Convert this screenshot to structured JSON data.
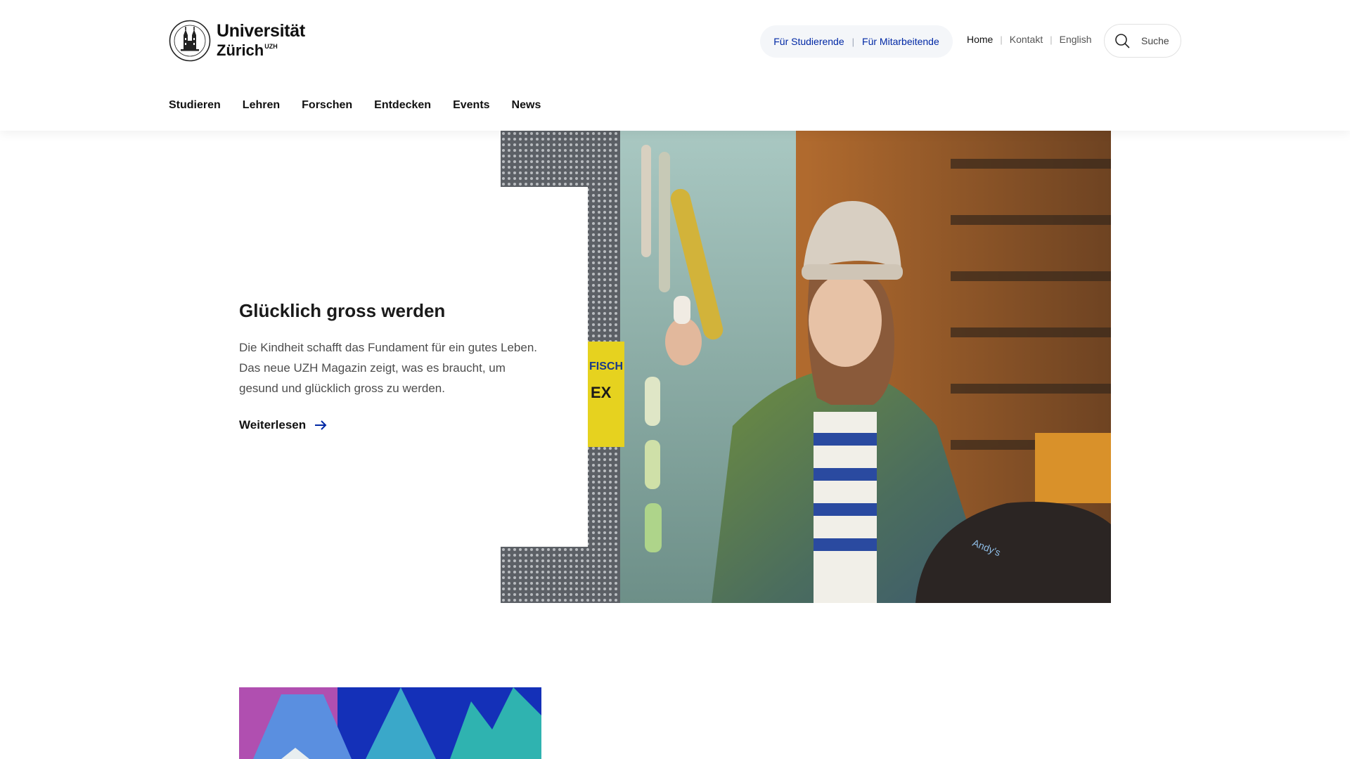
{
  "logo": {
    "line1": "Universität",
    "line2": "Zürich",
    "suffix": "UZH"
  },
  "audience_nav": {
    "items": [
      "Für Studierende",
      "Für Mitarbeitende"
    ]
  },
  "service_nav": {
    "items": [
      "Home",
      "Kontakt",
      "English"
    ]
  },
  "search": {
    "label": "Suche",
    "icon": "search-icon"
  },
  "main_nav": {
    "items": [
      "Studieren",
      "Lehren",
      "Forschen",
      "Entdecken",
      "Events",
      "News"
    ]
  },
  "hero": {
    "title": "Glücklich gross werden",
    "body": "Die Kindheit schafft das Fundament für ein gutes Leben. Das neue UZH Magazin zeigt, was es braucht, um gesund und glücklich gross zu werden.",
    "link": "Weiterlesen",
    "link_icon": "arrow-right-icon"
  },
  "colors": {
    "accent": "#0028a5",
    "text": "#1a1a1a"
  }
}
